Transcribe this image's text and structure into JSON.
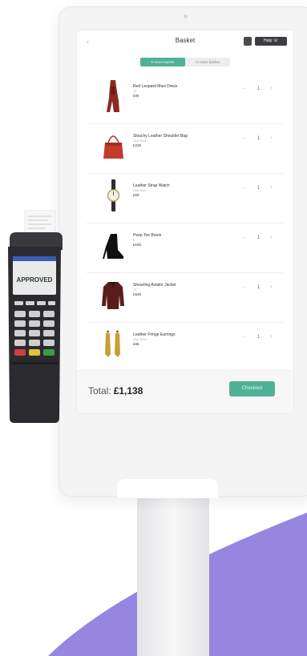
{
  "colors": {
    "accent": "#4fb196",
    "purple": "#9686e0"
  },
  "header": {
    "title": "Basket",
    "back_icon": "chevron-left-icon",
    "bag_icon": "shopping-bag-icon",
    "help_label": "Help ☏"
  },
  "tabs": [
    {
      "label": "E-store basket",
      "active": true
    },
    {
      "label": "In-store basket",
      "active": false
    }
  ],
  "items": [
    {
      "name": "Red Leopard Maxi Dress",
      "size": "10",
      "price": "£95",
      "qty": "1"
    },
    {
      "name": "Slouchy Leather Shoulder Bag",
      "size": "One Size",
      "price": "£225",
      "qty": "1"
    },
    {
      "name": "Leather Strap Watch",
      "size": "One Size",
      "price": "£69",
      "qty": "1"
    },
    {
      "name": "Peep Toe Boots",
      "size": "6",
      "price": "£155",
      "qty": "1"
    },
    {
      "name": "Shearling Aviator Jacket",
      "size": "12",
      "price": "£525",
      "qty": "1"
    },
    {
      "name": "Leather Fringe Earrings",
      "size": "One Size",
      "price": "£65",
      "qty": "1"
    }
  ],
  "stepper": {
    "minus": "–",
    "plus": "+"
  },
  "footer": {
    "total_label": "Total:",
    "total_value": "£1,138",
    "checkout_label": "Checkout"
  },
  "terminal": {
    "screen_text": "APPROVED"
  }
}
